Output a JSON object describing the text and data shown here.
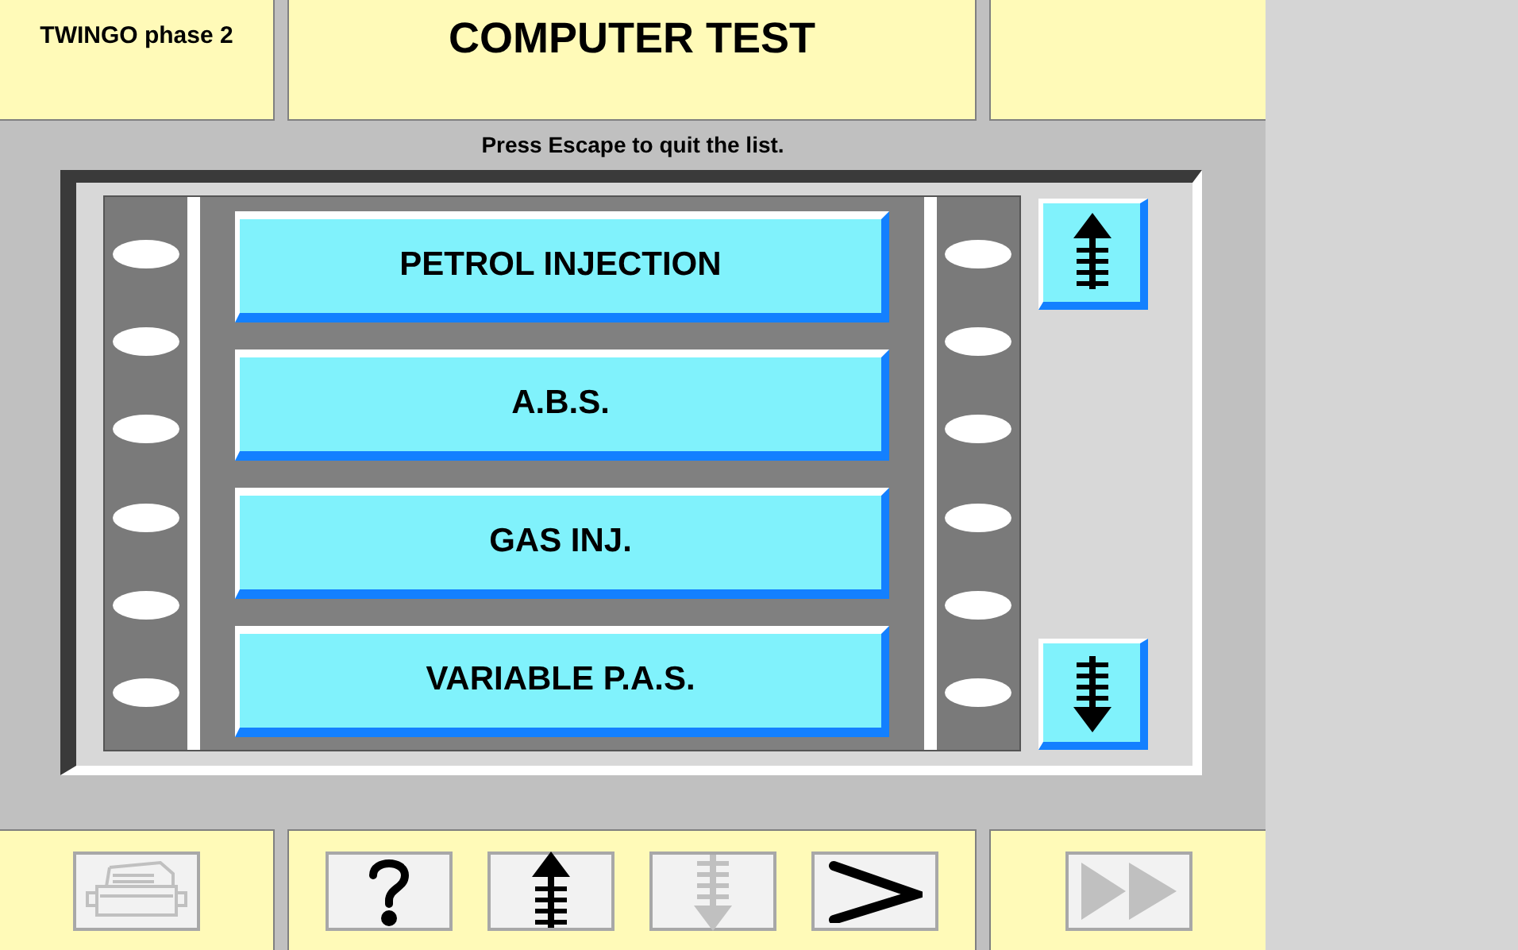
{
  "header": {
    "vehicle": "TWINGO phase 2",
    "title": "COMPUTER TEST"
  },
  "message": "Press Escape to quit the list.",
  "list": {
    "items": [
      {
        "label": "PETROL INJECTION"
      },
      {
        "label": "A.B.S."
      },
      {
        "label": "GAS INJ."
      },
      {
        "label": "VARIABLE P.A.S."
      }
    ],
    "scroll": [
      {
        "kind": "up"
      },
      {
        "kind": "down"
      }
    ]
  },
  "toolbar": {
    "left": [
      {
        "kind": "print",
        "disabled": true
      }
    ],
    "center": [
      {
        "kind": "help",
        "disabled": false
      },
      {
        "kind": "up",
        "disabled": false
      },
      {
        "kind": "down",
        "disabled": true
      },
      {
        "kind": "next",
        "disabled": false
      }
    ],
    "right": [
      {
        "kind": "forward",
        "disabled": true
      }
    ]
  }
}
